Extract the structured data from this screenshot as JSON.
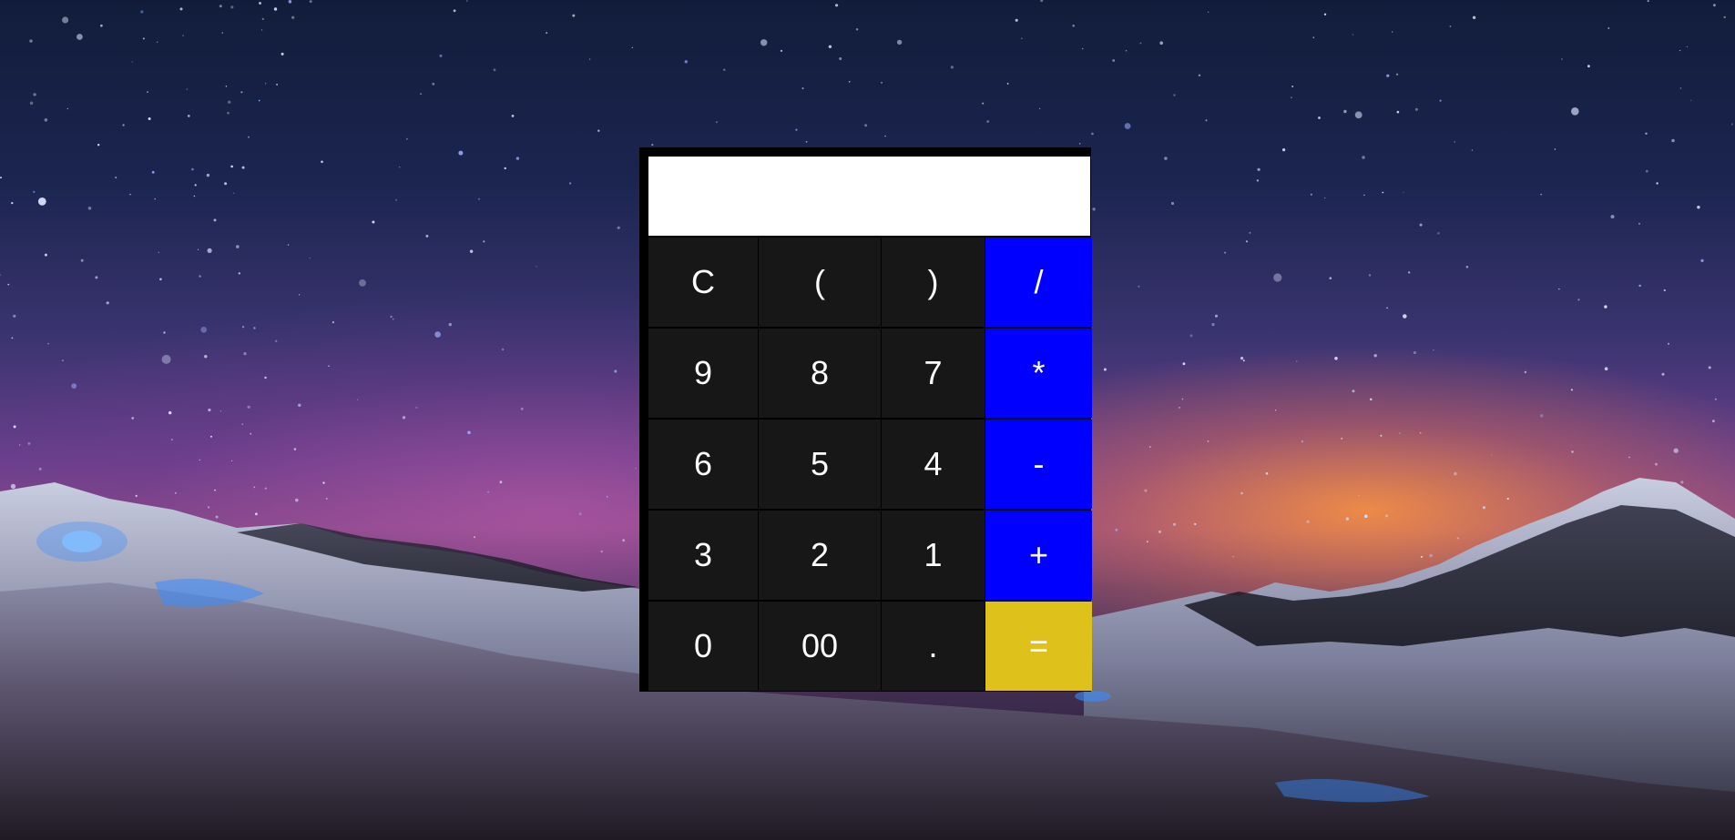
{
  "display": {
    "value": "",
    "placeholder": ""
  },
  "keys": [
    {
      "label": "C",
      "kind": "num"
    },
    {
      "label": "(",
      "kind": "num"
    },
    {
      "label": ")",
      "kind": "num"
    },
    {
      "label": "/",
      "kind": "op"
    },
    {
      "label": "9",
      "kind": "num"
    },
    {
      "label": "8",
      "kind": "num"
    },
    {
      "label": "7",
      "kind": "num"
    },
    {
      "label": "*",
      "kind": "op"
    },
    {
      "label": "6",
      "kind": "num"
    },
    {
      "label": "5",
      "kind": "num"
    },
    {
      "label": "4",
      "kind": "num"
    },
    {
      "label": "-",
      "kind": "op"
    },
    {
      "label": "3",
      "kind": "num"
    },
    {
      "label": "2",
      "kind": "num"
    },
    {
      "label": "1",
      "kind": "num"
    },
    {
      "label": "+",
      "kind": "op"
    },
    {
      "label": "0",
      "kind": "num"
    },
    {
      "label": "00",
      "kind": "num"
    },
    {
      "label": ".",
      "kind": "num"
    },
    {
      "label": "=",
      "kind": "eq"
    }
  ],
  "colors": {
    "number_key": "#171717",
    "operator_key": "#0000fe",
    "equals_key": "#dec11b",
    "display_bg": "#ffffff",
    "frame": "#000000"
  },
  "background": {
    "description_icon": "night-sky-mountains-image"
  }
}
